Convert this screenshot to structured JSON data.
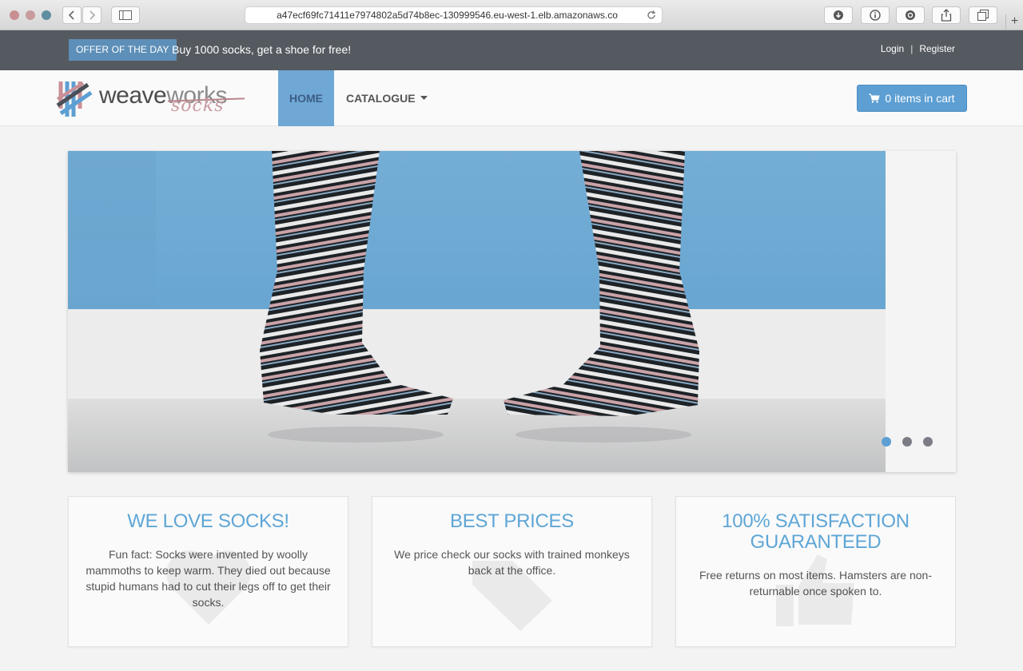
{
  "browser": {
    "url": "a47ecf69fc71411e7974802a5d74b8ec-130999546.eu-west-1.elb.amazonaws.co",
    "new_tab": "+"
  },
  "topbar": {
    "offer_badge": "OFFER OF THE DAY",
    "offer_text": "Buy 1000 socks, get a shoe for free!",
    "login": "Login",
    "separator": "|",
    "register": "Register"
  },
  "logo": {
    "part1": "weave",
    "part2": "works",
    "part3": "socks"
  },
  "nav": {
    "home": "HOME",
    "catalogue": "CATALOGUE",
    "cart": "0 items in cart"
  },
  "carousel": {
    "slide_count": 3,
    "active_index": 0
  },
  "features": [
    {
      "title": "WE LOVE SOCKS!",
      "text": "Fun fact: Socks were invented by woolly mammoths to keep warm. They died out because stupid humans had to cut their legs off to get their socks."
    },
    {
      "title": "BEST PRICES",
      "text": "We price check our socks with trained monkeys back at the office."
    },
    {
      "title": "100% SATISFACTION GUARANTEED",
      "text": "Free returns on most items. Hamsters are non-returnable once spoken to."
    }
  ],
  "colors": {
    "accent": "#5d9fd3",
    "topbar": "#555a60",
    "heading": "#5ea6d6"
  }
}
